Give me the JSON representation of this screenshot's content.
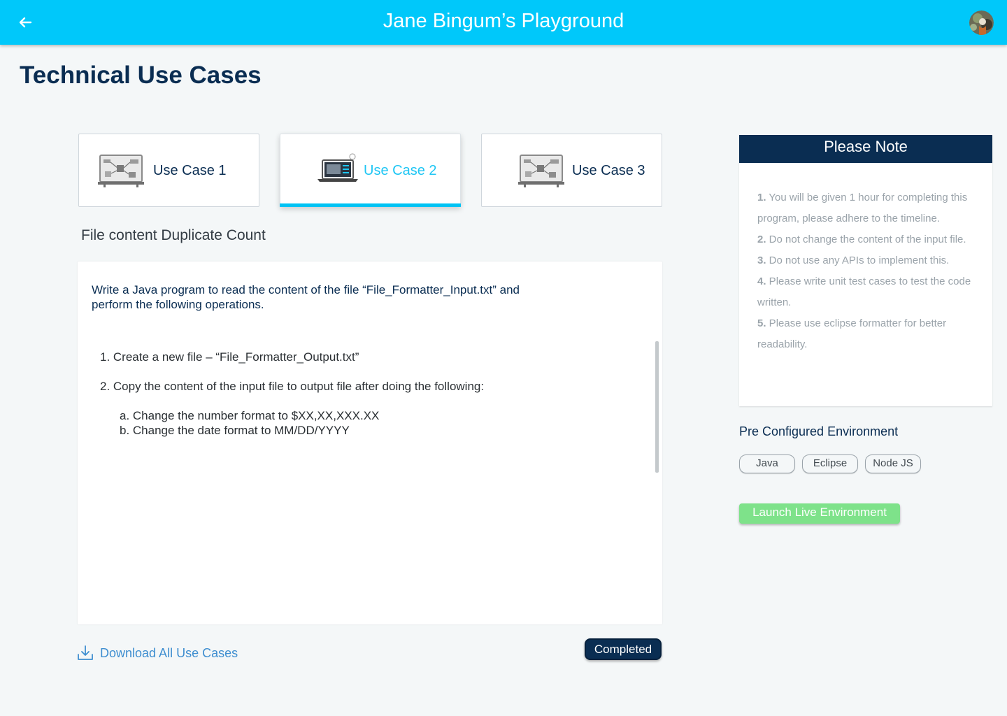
{
  "header": {
    "title": "Jane Bingum’s Playground",
    "back_icon": "arrow-left-icon",
    "avatar_icon": "user-avatar"
  },
  "page": {
    "title": "Technical Use Cases"
  },
  "tabs": [
    {
      "label": "Use Case 1",
      "icon": "whiteboard-diagram-icon",
      "active": false
    },
    {
      "label": "Use Case 2",
      "icon": "laptop-icon",
      "active": true
    },
    {
      "label": "Use Case 3",
      "icon": "whiteboard-diagram-icon",
      "active": false
    }
  ],
  "use_case": {
    "heading": "File content Duplicate Count",
    "intro_line1": "Write a Java program to read the content of the file “File_Formatter_Input.txt” and",
    "intro_line2": "perform the following operations.",
    "step1": "1. Create a new file – “File_Formatter_Output.txt”",
    "step2": "2. Copy the content of the input file to output file after doing the following:",
    "step2a": "a. Change the number format to $XX,XX,XXX.XX",
    "step2b": "b. Change the date format to MM/DD/YYYY"
  },
  "footer": {
    "download_label": "Download All Use Cases",
    "download_icon": "download-icon",
    "completed_label": "Completed"
  },
  "note": {
    "title": "Please Note",
    "items": [
      {
        "num": "1.",
        "text": " You will be given 1 hour for completing this program, please adhere to the timeline."
      },
      {
        "num": "2.",
        "text": " Do not change the content of the input file."
      },
      {
        "num": "3.",
        "text": " Do not use any APIs to implement this."
      },
      {
        "num": "4.",
        "text": " Please write unit test cases to test the code written."
      },
      {
        "num": "5.",
        "text": " Please use eclipse formatter for better readability."
      }
    ]
  },
  "environment": {
    "heading": "Pre Configured Environment",
    "chips": [
      "Java",
      "Eclipse",
      "Node JS"
    ],
    "launch_label": "Launch Live Environment"
  },
  "colors": {
    "header_bg": "#00c8fa",
    "navy": "#0a2d52",
    "accent_cyan": "#1fc6f4",
    "link_blue": "#3e8ed0",
    "launch_green": "#7ee28a"
  }
}
